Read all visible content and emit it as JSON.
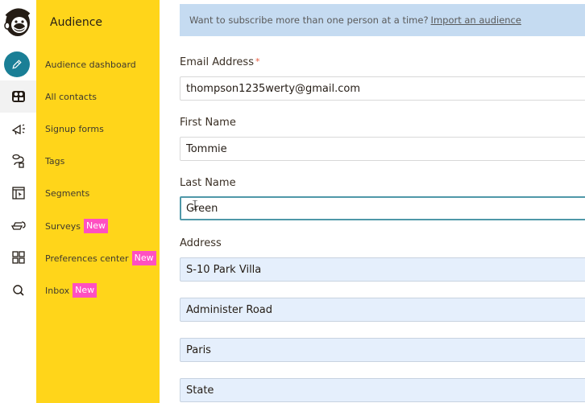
{
  "rail": {
    "items": [
      {
        "icon": "mailchimp-logo-icon"
      },
      {
        "icon": "pencil-create-icon"
      },
      {
        "icon": "audience-contacts-icon",
        "active": true
      },
      {
        "icon": "megaphone-campaigns-icon"
      },
      {
        "icon": "automations-icon"
      },
      {
        "icon": "website-pages-icon"
      },
      {
        "icon": "content-integrations-icon"
      },
      {
        "icon": "grid-apps-icon"
      },
      {
        "icon": "search-icon"
      }
    ]
  },
  "sidebar": {
    "title": "Audience",
    "items": [
      {
        "label": "Audience dashboard"
      },
      {
        "label": "All contacts"
      },
      {
        "label": "Signup forms"
      },
      {
        "label": "Tags"
      },
      {
        "label": "Segments"
      },
      {
        "label": "Surveys",
        "badge": "New"
      },
      {
        "label": "Preferences center",
        "badge": "New"
      },
      {
        "label": "Inbox",
        "badge": "New"
      }
    ],
    "badge_color": "#ff4fc1",
    "background": "#ffd51a"
  },
  "banner": {
    "text": "Want to subscribe more than one person at a time?",
    "link": "Import an audience"
  },
  "form": {
    "email": {
      "label": "Email Address",
      "required_mark": "*",
      "value": "thompson1235werty@gmail.com"
    },
    "first_name": {
      "label": "First Name",
      "value": "Tommie"
    },
    "last_name": {
      "label": "Last Name",
      "value": "Green"
    },
    "address": {
      "label": "Address",
      "line1": "S-10 Park Villa",
      "line2": "Administer Road",
      "city": "Paris",
      "state": "State"
    }
  },
  "colors": {
    "accent_teal": "#1a7f96",
    "focus_border": "#4f98a8",
    "banner_bg": "#c5dbf1",
    "autofill_bg": "#e5effc",
    "required": "#e85c41"
  }
}
